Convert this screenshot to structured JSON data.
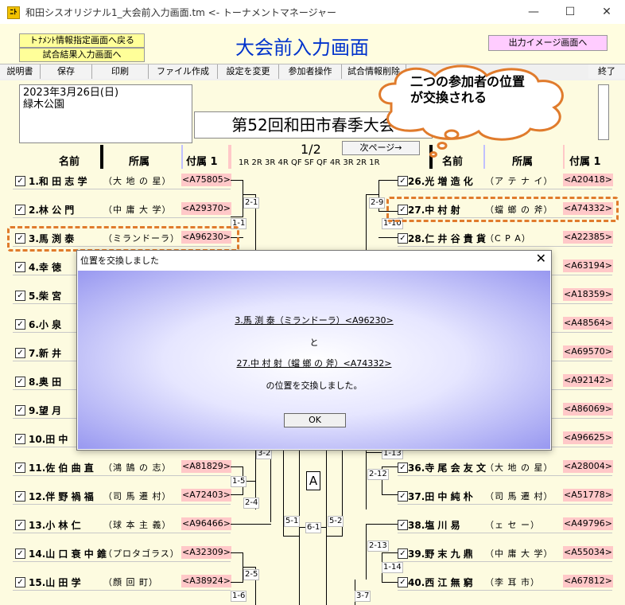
{
  "window": {
    "title": "和田シスオリジナル1_大会前入力画面.tm <- トーナメントマネージャー",
    "icon_glyph": "ﾆﾄ"
  },
  "header": {
    "btn_back": "トﾅﾒﾝﾄ情報指定画面へ戻る",
    "btn_results": "試合結果入力画面へ",
    "title": "大会前入力画面",
    "btn_output": "出力イメージ画面へ"
  },
  "menu": [
    "説明書",
    "保存",
    "印刷",
    "ファイル作成",
    "設定を変更",
    "参加者操作",
    "試合情報削除",
    "終了"
  ],
  "info": {
    "line1": "2023年3月26日(日)",
    "line2": "緑木公園"
  },
  "tournament_title": "第52回和田市春季大会",
  "page": {
    "indicator": "1/2",
    "next": "次ページ→"
  },
  "rounds": "1R 2R 3R 4R QF SF QF 4R 3R 2R 1R",
  "columns": {
    "name": "名前",
    "aff": "所属",
    "code": "付属 1"
  },
  "left_players": [
    {
      "num": "1.",
      "name": "和 田  志 学",
      "aff": "（大 地 の 星）",
      "code": "<A75805>"
    },
    {
      "num": "2.",
      "name": "林   公  門",
      "aff": "（中 庸 大 学）",
      "code": "<A29370>"
    },
    {
      "num": "3.",
      "name": "馬  渕   泰",
      "aff": "（ミランドーラ）",
      "code": "<A96230>"
    },
    {
      "num": "4.",
      "name": "幸 徳",
      "aff": "",
      "code": ""
    },
    {
      "num": "5.",
      "name": "柴 宮",
      "aff": "",
      "code": ""
    },
    {
      "num": "6.",
      "name": "小 泉",
      "aff": "",
      "code": ""
    },
    {
      "num": "7.",
      "name": "新 井",
      "aff": "",
      "code": ""
    },
    {
      "num": "8.",
      "name": "奥 田",
      "aff": "",
      "code": ""
    },
    {
      "num": "9.",
      "name": "望 月",
      "aff": "",
      "code": ""
    },
    {
      "num": "10.",
      "name": "田 中",
      "aff": "",
      "code": ""
    },
    {
      "num": "11.",
      "name": "佐 伯  曲 直",
      "aff": "（鴻 鵠 の 志）",
      "code": "<A81829>"
    },
    {
      "num": "12.",
      "name": "伴 野  禍 福",
      "aff": "（司 馬 遷 村）",
      "code": "<A72403>"
    },
    {
      "num": "13.",
      "name": "小  林   仁",
      "aff": "（球 本 主 義）",
      "code": "<A96466>"
    },
    {
      "num": "14.",
      "name": "山 口  衰 中 錐",
      "aff": "（プロタゴラス）",
      "code": "<A32309>"
    },
    {
      "num": "15.",
      "name": "山  田   学",
      "aff": "（顔  回  町）",
      "code": "<A38924>"
    }
  ],
  "right_players": [
    {
      "num": "26.",
      "name": "光 増  造 化",
      "aff": "（ア テ ナ イ）",
      "code": "<A20418>"
    },
    {
      "num": "27.",
      "name": "中  村   射",
      "aff": "（蟷 螂 の 斧）",
      "code": "<A74332>"
    },
    {
      "num": "28.",
      "name": "仁 井 谷  貴 貨",
      "aff": "（C   P   A）",
      "code": "<A22385>"
    },
    {
      "num": "",
      "name": "",
      "aff": "",
      "code": "<A63194>"
    },
    {
      "num": "",
      "name": "",
      "aff": "",
      "code": "<A18359>"
    },
    {
      "num": "",
      "name": "",
      "aff": "",
      "code": "<A48564>"
    },
    {
      "num": "",
      "name": "",
      "aff": "",
      "code": "<A69570>"
    },
    {
      "num": "",
      "name": "",
      "aff": "",
      "code": "<A92142>"
    },
    {
      "num": "",
      "name": "",
      "aff": "",
      "code": "<A86069>"
    },
    {
      "num": "",
      "name": "",
      "aff": "",
      "code": "<A96625>"
    },
    {
      "num": "36.",
      "name": "寺 尾  会 友 文",
      "aff": "（大 地 の 星）",
      "code": "<A28004>"
    },
    {
      "num": "37.",
      "name": "田 中  純 朴",
      "aff": "（司 馬 遷 村）",
      "code": "<A51778>"
    },
    {
      "num": "38.",
      "name": "塩  川   易",
      "aff": "（ェ  セ  ー）",
      "code": "<A49796>"
    },
    {
      "num": "39.",
      "name": "野 末  九 鼎",
      "aff": "（中 庸 大 学）",
      "code": "<A55034>"
    },
    {
      "num": "40.",
      "name": "西 江  無 窮",
      "aff": "（李  耳  市）",
      "code": "<A67812>"
    }
  ],
  "matches": {
    "m2_1": "2-1",
    "m1_1": "1-1",
    "m2_9": "2-9",
    "m1_10": "1-10",
    "m3_2": "3-2",
    "m1_5": "1-5",
    "m2_4": "2-4",
    "m2_5": "2-5",
    "m1_6": "1-6",
    "m5_1": "5-1",
    "m6_1": "6-1",
    "m5_2": "5-2",
    "m1_13": "1-13",
    "m2_12": "2-12",
    "m2_13": "2-13",
    "m1_14": "1-14",
    "m3_7": "3-7",
    "block": "A"
  },
  "callout": {
    "line1": "二つの参加者の位置",
    "line2": "が交換される"
  },
  "dialog": {
    "title": "位置を交換しました",
    "close": "✕",
    "player1": "3.馬  渕   泰（ミランドーラ）<A96230>",
    "and": "と",
    "player2": "27.中  村   射（蟷 螂 の 斧）<A74332>",
    "message": "の位置を交換しました。",
    "ok": "OK"
  },
  "checkbox_mark": "☑"
}
